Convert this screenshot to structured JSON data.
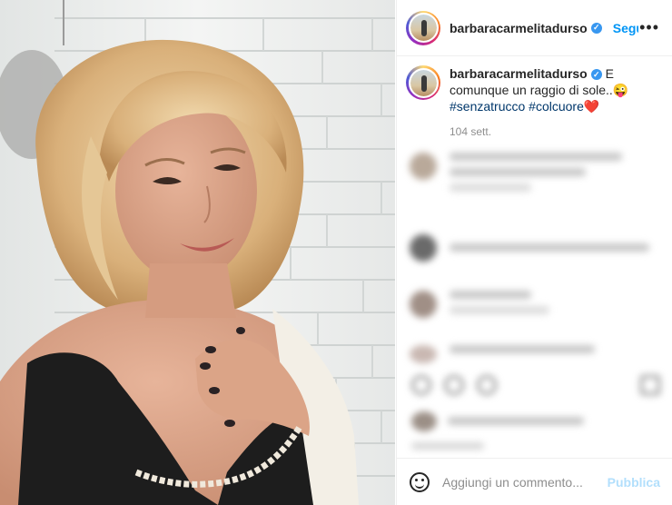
{
  "post": {
    "username": "barbaracarmelitadurso",
    "follow_label": "Segui",
    "more_icon": "more-horizontal-icon",
    "verified_icon": "verified-badge-icon"
  },
  "caption": {
    "username": "barbaracarmelitadurso",
    "text": "E comunque un raggio di sole..😜",
    "hashtag_1": "#senzatrucco",
    "hashtag_2": "#colcuore",
    "heart": "❤️",
    "time": "104 sett."
  },
  "comment_bar": {
    "placeholder": "Aggiungi un commento...",
    "publish_label": "Pubblica",
    "emoji_icon": "emoji-smile-icon"
  },
  "colors": {
    "accent": "#0095f6",
    "publish_disabled": "#b2dffc",
    "hashtag": "#00376b",
    "verified": "#3897f0"
  }
}
